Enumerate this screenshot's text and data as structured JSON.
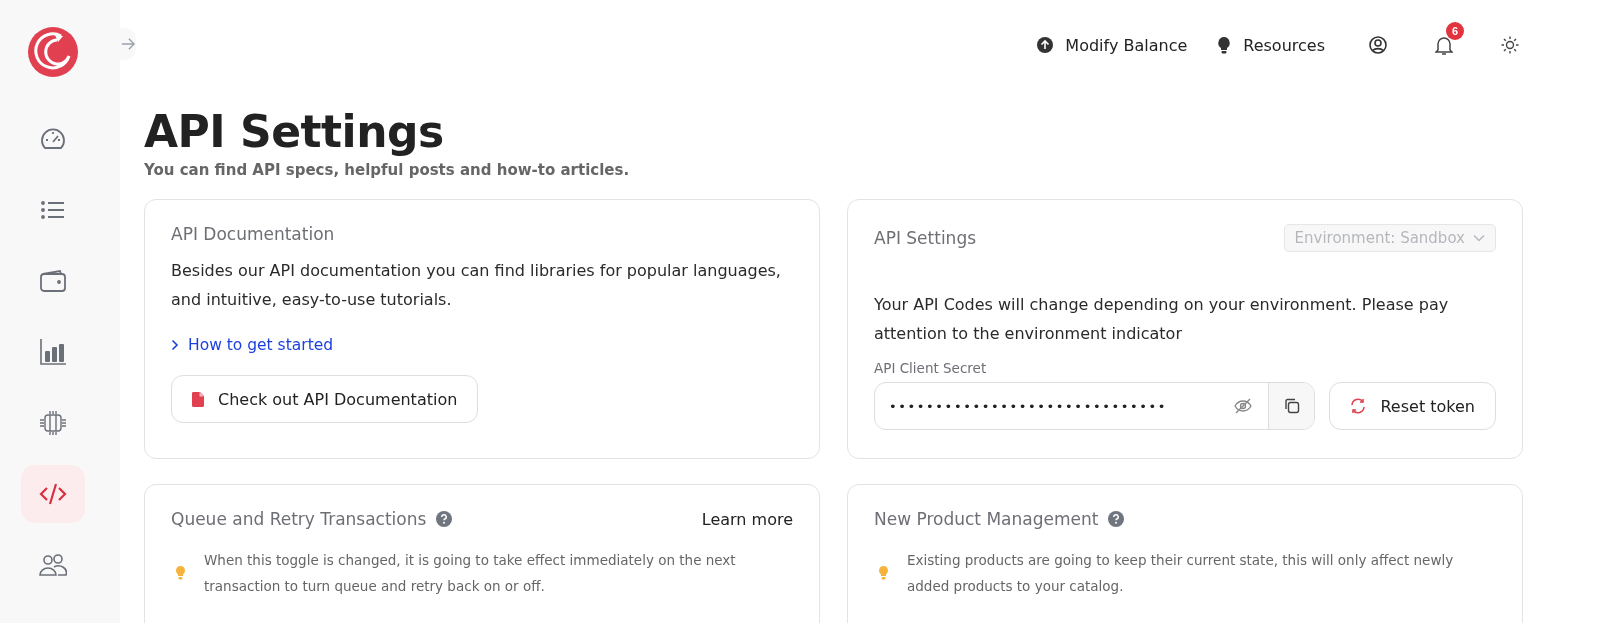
{
  "sidebar": {
    "items": [
      {
        "kind": "gauge",
        "selected": false
      },
      {
        "kind": "list",
        "selected": false
      },
      {
        "kind": "wallet",
        "selected": false
      },
      {
        "kind": "chart",
        "selected": false
      },
      {
        "kind": "chip",
        "selected": false
      },
      {
        "kind": "code",
        "selected": true
      },
      {
        "kind": "users",
        "selected": false
      }
    ]
  },
  "topbar": {
    "actions": [
      {
        "kind": "upload",
        "label": "Modify Balance"
      },
      {
        "kind": "bulb",
        "label": "Resources"
      }
    ],
    "notification_count": "6"
  },
  "page": {
    "title": "API Settings",
    "subtitle": "You can find API specs, helpful posts and how-to articles."
  },
  "documentation": {
    "title": "API Documentation",
    "text": "Besides our API documentation you can find libraries for popular languages, and intuitive, easy-to-use tutorials.",
    "link": "How to get started",
    "button": "Check out API Documentation"
  },
  "api_settings": {
    "title": "API Settings",
    "environment": {
      "label": "Environment: Sandbox",
      "disabled": true
    },
    "text": "Your API Codes will change depending on your environment. Please pay attention to the environment indicator",
    "secret_label": "API Client Secret",
    "secret_value": "••••••••••••••••••••••••••••••",
    "reset_button": "Reset token"
  },
  "queue": {
    "title": "Queue and Retry Transactions",
    "link": "Learn more",
    "hint": "When this toggle is changed, it is going to take effect immediately on the next transaction to turn queue and retry back on or off."
  },
  "products": {
    "title": "New Product Management",
    "hint": "Existing products are going to keep their current state, this will only affect newly added products to your catalog."
  }
}
